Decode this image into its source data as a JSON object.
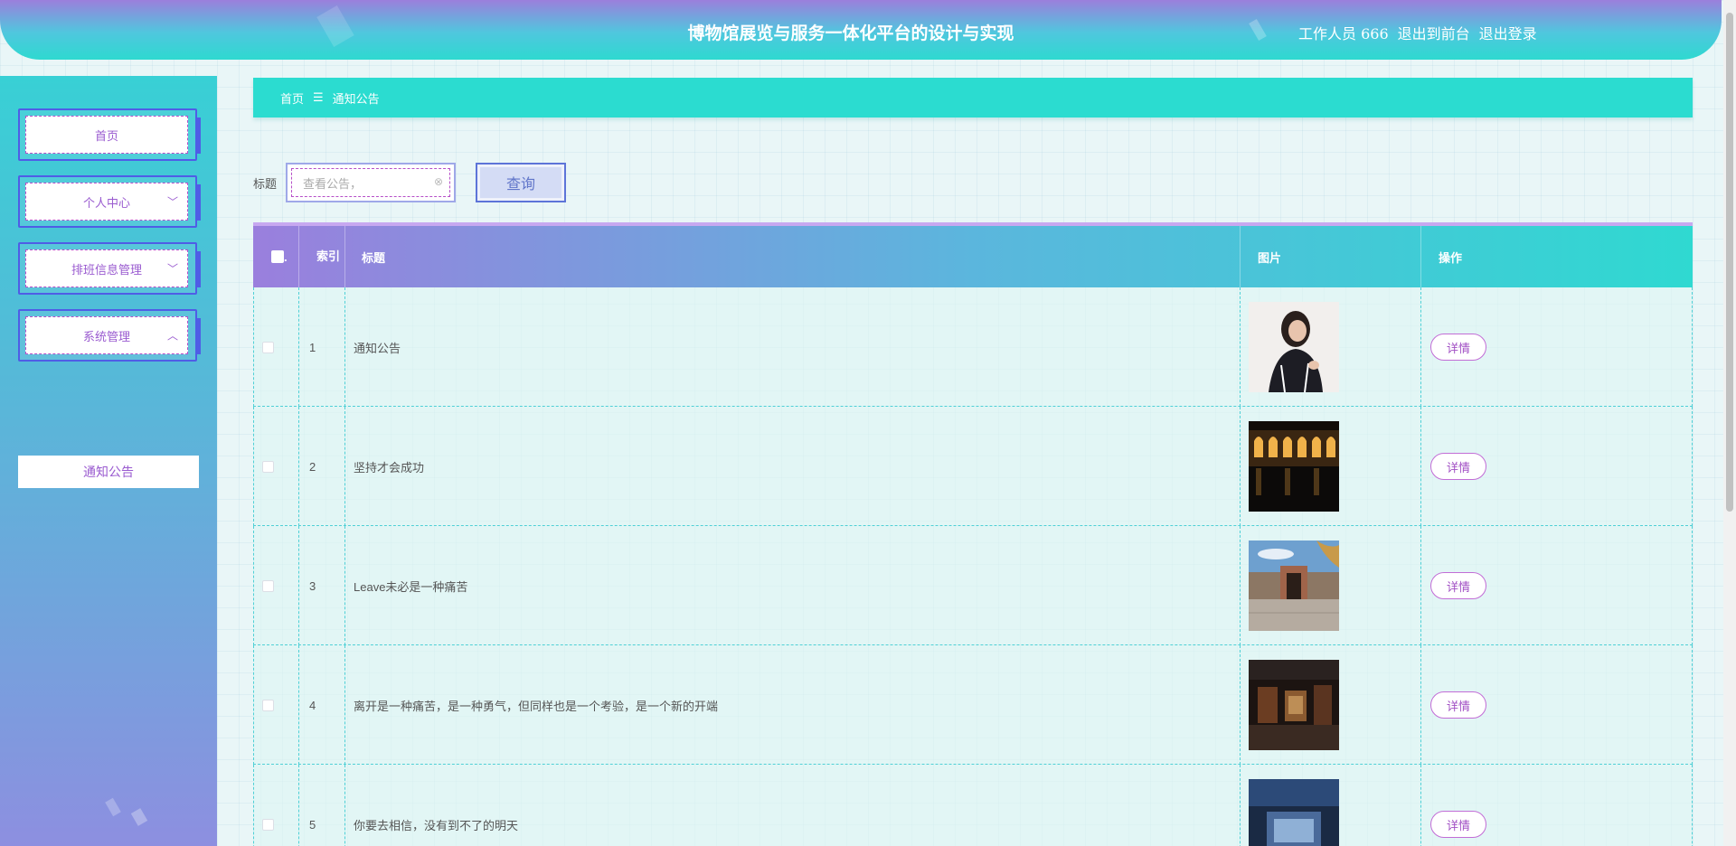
{
  "header": {
    "title": "博物馆展览与服务一体化平台的设计与实现",
    "user": "工作人员 666",
    "to_front": "退出到前台",
    "logout": "退出登录"
  },
  "sidebar": {
    "items": [
      {
        "label": "首页"
      },
      {
        "label": "个人中心"
      },
      {
        "label": "排班信息管理"
      },
      {
        "label": "系统管理"
      }
    ],
    "sub_item": "通知公告"
  },
  "breadcrumb": {
    "home": "首页",
    "separator": "☰",
    "current": "通知公告"
  },
  "search": {
    "label": "标题",
    "placeholder": "查看公告，",
    "button": "查询"
  },
  "table": {
    "headers": {
      "index": "索引",
      "title": "标题",
      "image": "图片",
      "action": "操作"
    },
    "detail_label": "详情",
    "rows": [
      {
        "index": "1",
        "title": "通知公告",
        "image": "portrait-photo"
      },
      {
        "index": "2",
        "title": "坚持才会成功",
        "image": "night-arcade-photo"
      },
      {
        "index": "3",
        "title": "Leave未必是一种痛苦",
        "image": "museum-building-photo"
      },
      {
        "index": "4",
        "title": "离开是一种痛苦，是一种勇气，但同样也是一个考验，是一个新的开端",
        "image": "exhibit-hall-photo"
      },
      {
        "index": "5",
        "title": "你要去相信，没有到不了的明天",
        "image": "gallery-interior-photo"
      }
    ]
  },
  "colors": {
    "accent_teal": "#2bdcd0",
    "accent_purple": "#9a7fdd",
    "button_border": "#c26dd6"
  }
}
